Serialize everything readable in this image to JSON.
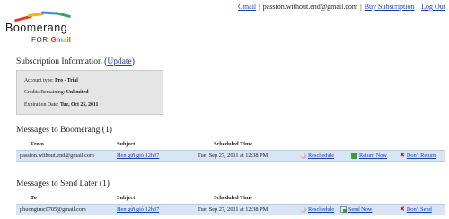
{
  "logo": {
    "name": "Boomerang",
    "for_text": "FOR",
    "for_brand": "Gmail",
    "bar_colors": [
      "#e33b2e",
      "#f4b400",
      "#4285f4",
      "#34a853"
    ]
  },
  "top_links": {
    "gmail": "Gmail",
    "email": "passion.without.end@gmail.com",
    "buy_subscription": "Buy Subscription",
    "log_out": "Log Out",
    "separator": "|"
  },
  "subscription": {
    "title": "Subscription Information",
    "update_open": "(",
    "update_link": "Update",
    "update_close": ")",
    "account_type_label": "Account type:",
    "account_type_value": "Pro - Trial",
    "credits_label": "Credits Remaining:",
    "credits_value": "Unlimited",
    "expiration_label": "Expiration Date:",
    "expiration_value": "Tue, Oct 25, 2011"
  },
  "boomerang_section": {
    "title": "Messages to Boomerang (1)",
    "columns": {
      "from": "From",
      "subject": "Subject",
      "scheduled": "Scheduled Time"
    },
    "rows": [
      {
        "from": "passion.without.end@gmail.com",
        "subject": "Hen gửi gió 12h37",
        "scheduled": "Tue, Sep 27, 2011 at 12:38 PM",
        "reschedule": "Reschedule",
        "return_now": "Return Now",
        "dont_return": "Don't Return"
      }
    ]
  },
  "send_later_section": {
    "title": "Messages to Send Later (1)",
    "columns": {
      "to": "To",
      "subject": "Subject",
      "scheduled": "Scheduled Time"
    },
    "rows": [
      {
        "to": "phuongtruc0705@gmail.com",
        "subject": "Hen gửi gió 12h37",
        "scheduled": "Tue, Sep 27, 2011 at 12:38 PM",
        "reschedule": "Reschedule",
        "send_now": "Send Now",
        "dont_send": "Don't Send"
      }
    ]
  },
  "icons": {
    "reschedule": "clock-icon",
    "return_now": "return-arrow-icon",
    "send_now": "send-envelope-icon",
    "dont": "red-x-icon"
  }
}
